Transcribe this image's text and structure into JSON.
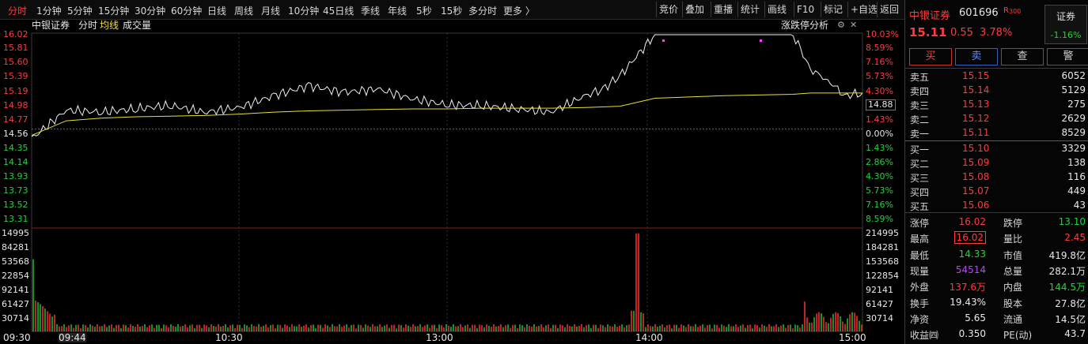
{
  "toolbar": {
    "periods": [
      "分时",
      "1分钟",
      "5分钟",
      "15分钟",
      "30分钟",
      "60分钟",
      "日线",
      "周线",
      "月线",
      "10分钟",
      "45日线",
      "季线",
      "年线",
      "5秒",
      "15秒",
      "多分时",
      "更多 〉"
    ],
    "active_period": "分时",
    "tools": [
      "竞价",
      "叠加",
      "重播",
      "统计",
      "画线",
      "F10",
      "标记",
      "+自选",
      "返回"
    ]
  },
  "chart_header": {
    "stock_name": "中银证券",
    "mode": "分时",
    "avg_label": "均线",
    "volume_label": "成交量",
    "analysis_label": "涨跌停分析"
  },
  "price_axis": {
    "left_red": [
      "16.02",
      "15.81",
      "15.60",
      "15.39",
      "15.19",
      "14.98",
      "14.77"
    ],
    "mid": "14.56",
    "left_green": [
      "14.35",
      "14.14",
      "13.93",
      "13.73",
      "13.52",
      "13.31"
    ],
    "right_red": [
      "10.03%",
      "8.59%",
      "7.16%",
      "5.73%",
      "4.30%",
      "2.86%",
      "1.43%"
    ],
    "right_mid": "0.00%",
    "right_green": [
      "1.43%",
      "2.86%",
      "4.30%",
      "5.73%",
      "7.16%",
      "8.59%"
    ],
    "current_marker": "14.88"
  },
  "volume_axis": {
    "left": [
      "14995",
      "84281",
      "53568",
      "22854",
      "92141",
      "61427",
      "30714"
    ],
    "right": [
      "214995",
      "184281",
      "153568",
      "122854",
      "92141",
      "61427",
      "30714"
    ]
  },
  "time_axis": [
    "09:30",
    "09:44",
    "10:30",
    "13:00",
    "14:00",
    "15:00"
  ],
  "chart_data": {
    "type": "line",
    "title": "中银证券 分时",
    "xlabel": "",
    "ylabel": "",
    "prev_close": 14.56,
    "ylim": [
      13.1,
      16.02
    ],
    "x": [
      "09:30",
      "09:40",
      "09:50",
      "10:00",
      "10:10",
      "10:20",
      "10:30",
      "10:40",
      "10:50",
      "11:00",
      "11:10",
      "11:20",
      "11:30",
      "13:10",
      "13:20",
      "13:30",
      "13:40",
      "13:45",
      "13:50",
      "14:00",
      "14:10",
      "14:20",
      "14:30",
      "14:40",
      "14:45",
      "14:50",
      "14:55",
      "15:00"
    ],
    "series": [
      {
        "name": "",
        "values": [
          14.45,
          14.88,
          14.85,
          14.9,
          14.95,
          14.85,
          14.92,
          15.1,
          15.25,
          15.15,
          15.2,
          15.05,
          14.96,
          14.95,
          14.9,
          14.85,
          15.1,
          15.2,
          15.4,
          16.02,
          16.02,
          16.02,
          16.02,
          16.02,
          15.5,
          15.33,
          15.1,
          15.14
        ]
      },
      {
        "name": "均线",
        "values": [
          14.5,
          14.72,
          14.76,
          14.78,
          14.79,
          14.8,
          14.82,
          14.85,
          14.87,
          14.88,
          14.89,
          14.9,
          14.9,
          14.91,
          14.91,
          14.91,
          14.92,
          14.93,
          14.94,
          15.06,
          15.08,
          15.1,
          15.11,
          15.12,
          15.14,
          15.14,
          15.14,
          15.14
        ]
      }
    ],
    "volume": {
      "name": "成交量",
      "peak_time": "13:55",
      "peak_value": 204000
    }
  },
  "quote": {
    "name": "中银证券",
    "code": "601696",
    "flag": "R",
    "flag_sub": "300",
    "price": "15.11",
    "change": "0.55",
    "change_pct": "3.78%",
    "sector": "证券",
    "sector_pct": "-1.16%",
    "buttons": [
      "买",
      "卖",
      "查",
      "警"
    ]
  },
  "order_book": {
    "asks": [
      {
        "label": "卖五",
        "price": "15.15",
        "vol": "6052"
      },
      {
        "label": "卖四",
        "price": "15.14",
        "vol": "5129"
      },
      {
        "label": "卖三",
        "price": "15.13",
        "vol": "275"
      },
      {
        "label": "卖二",
        "price": "15.12",
        "vol": "2629"
      },
      {
        "label": "卖一",
        "price": "15.11",
        "vol": "8529"
      }
    ],
    "bids": [
      {
        "label": "买一",
        "price": "15.10",
        "vol": "3329"
      },
      {
        "label": "买二",
        "price": "15.09",
        "vol": "138"
      },
      {
        "label": "买三",
        "price": "15.08",
        "vol": "116"
      },
      {
        "label": "买四",
        "price": "15.07",
        "vol": "449"
      },
      {
        "label": "买五",
        "price": "15.06",
        "vol": "43"
      }
    ]
  },
  "stats": [
    {
      "l1": "涨停",
      "v1": "16.02",
      "c1": "#ff3b3b",
      "l2": "跌停",
      "v2": "13.10",
      "c2": "#22d33a"
    },
    {
      "l1": "最高",
      "v1": "16.02",
      "c1": "#ff3b3b",
      "l2": "量比",
      "v2": "2.45",
      "c2": "#ff3b3b"
    },
    {
      "l1": "最低",
      "v1": "14.33",
      "c1": "#22d33a",
      "l2": "市值",
      "v2": "419.8亿",
      "c2": "#e8e8e8"
    },
    {
      "l1": "现量",
      "v1": "54514",
      "c1": "#c040ff",
      "l2": "总量",
      "v2": "282.1万",
      "c2": "#e8e8e8"
    },
    {
      "l1": "外盘",
      "v1": "137.6万",
      "c1": "#ff3b3b",
      "l2": "内盘",
      "v2": "144.5万",
      "c2": "#22d33a"
    },
    {
      "l1": "换手",
      "v1": "19.43%",
      "c1": "#e8e8e8",
      "l2": "股本",
      "v2": "27.8亿",
      "c2": "#e8e8e8"
    },
    {
      "l1": "净资",
      "v1": "5.65",
      "c1": "#e8e8e8",
      "l2": "流通",
      "v2": "14.5亿",
      "c2": "#e8e8e8"
    },
    {
      "l1": "收益㈣",
      "v1": "0.350",
      "c1": "#e8e8e8",
      "l2": "PE(动)",
      "v2": "43.7",
      "c2": "#e8e8e8"
    }
  ]
}
